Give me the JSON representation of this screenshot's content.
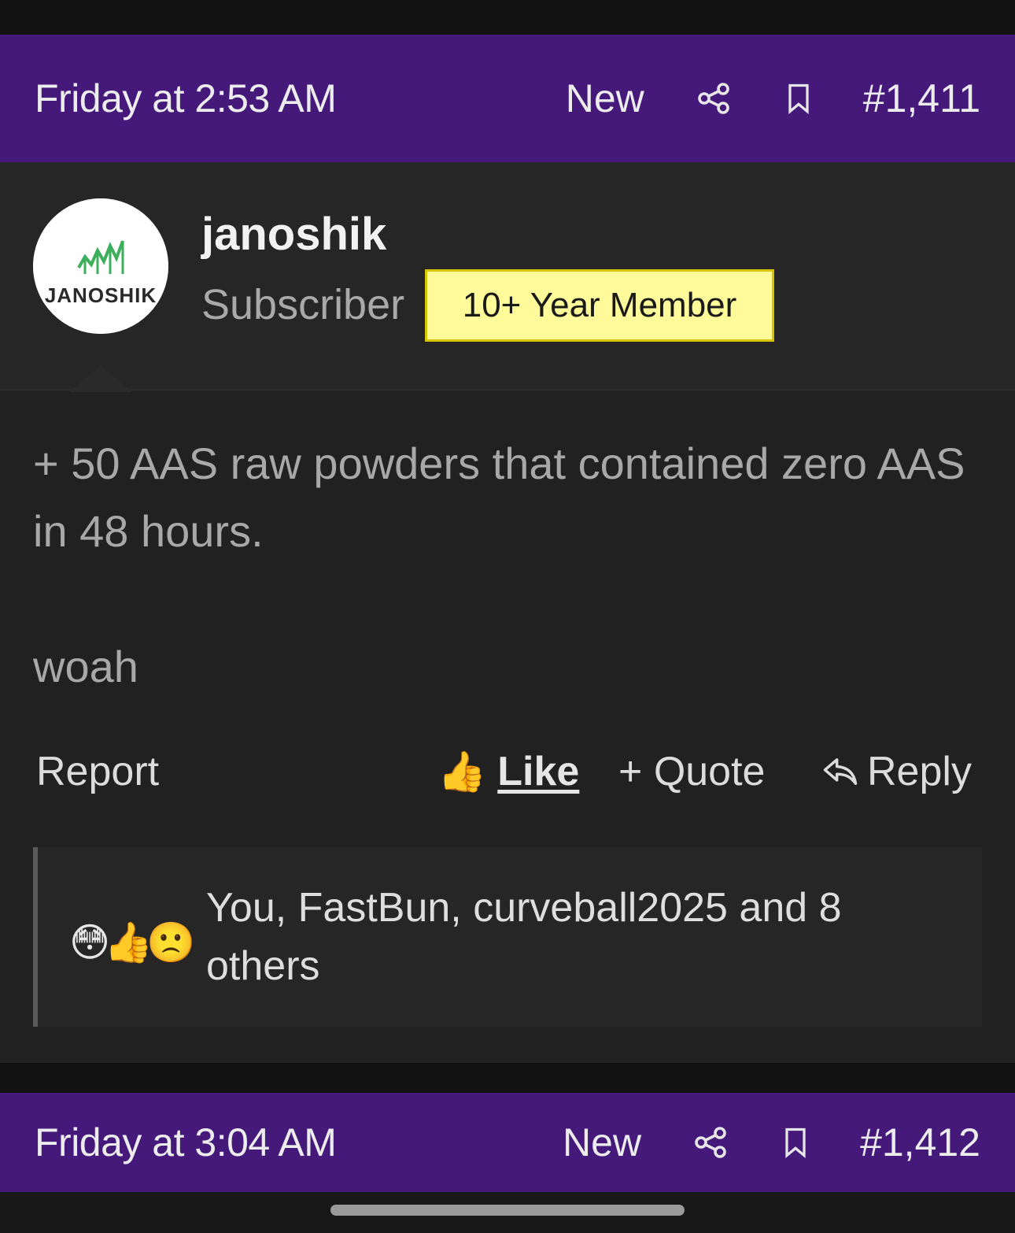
{
  "posts": [
    {
      "date": "Friday at 2:53 AM",
      "new_label": "New",
      "number": "#1,411",
      "author": {
        "name": "janoshik",
        "role": "Subscriber",
        "badge": "10+ Year Member",
        "avatar_text": "JANOSHIK"
      },
      "content": [
        "+ 50 AAS raw powders that contained zero AAS in 48 hours.",
        "woah"
      ],
      "actions": {
        "report": "Report",
        "like": "Like",
        "quote": "+ Quote",
        "reply": "Reply"
      },
      "reactions": {
        "emojis": [
          "😳",
          "👍",
          "🙁"
        ],
        "text": "You, FastBun, curveball2025 and 8 others"
      }
    },
    {
      "date": "Friday at 3:04 AM",
      "new_label": "New",
      "number": "#1,412"
    }
  ],
  "colors": {
    "header_purple": "#44197a",
    "badge_yellow": "#fffb9a",
    "post_bg": "#212121"
  },
  "icons": [
    "share-icon",
    "bookmark-icon",
    "thumbs-up-icon",
    "reply-icon"
  ]
}
